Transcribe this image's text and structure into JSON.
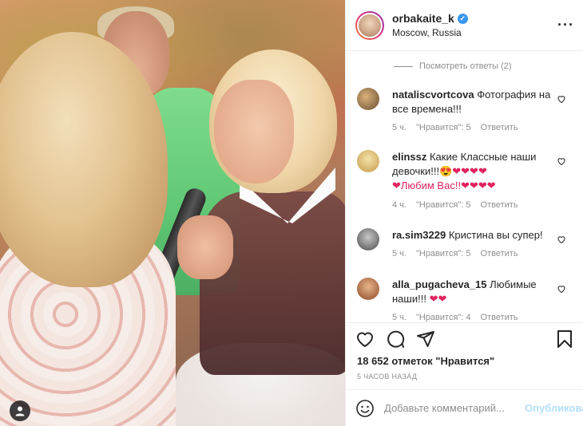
{
  "header": {
    "username": "orbakaite_k",
    "location": "Moscow, Russia",
    "more_icon": "ellipsis-icon",
    "verified_icon": "verified-badge-icon"
  },
  "replies": {
    "label": "Посмотреть ответы (2)"
  },
  "comments": [
    {
      "username": "nataliscvortcova",
      "text": "Фотография на все времена!!!",
      "time": "5 ч.",
      "likes": "\"Нравится\": 5",
      "reply": "Ответить"
    },
    {
      "username": "elinssz",
      "text": "Какие Классные наши девочки!!!",
      "emoji_line_1": "😍❤❤❤❤",
      "text2": "❤Любим Вас!!",
      "emoji_line_2": "❤❤❤❤",
      "time": "4 ч.",
      "likes": "\"Нравится\": 5",
      "reply": "Ответить"
    },
    {
      "username": "ra.sim3229",
      "text": "Кристина вы супер!",
      "time": "5 ч.",
      "likes": "\"Нравится\": 5",
      "reply": "Ответить"
    },
    {
      "username": "alla_pugacheva_15",
      "text": "Любимые наши!!!",
      "emoji": "❤❤",
      "time": "5 ч.",
      "likes": "\"Нравится\": 4",
      "reply": "Ответить"
    }
  ],
  "actions": {
    "likes_count": "18 652 отметок \"Нравится\"",
    "time_ago": "5 часов назад"
  },
  "add_comment": {
    "placeholder": "Добавьте комментарий...",
    "post_label": "Опубликовать"
  },
  "colors": {
    "link_blue": "#3897f0",
    "post_button_disabled": "#b2dffc",
    "muted_text": "#8e8e8e",
    "heart_red": "#e0245e"
  }
}
